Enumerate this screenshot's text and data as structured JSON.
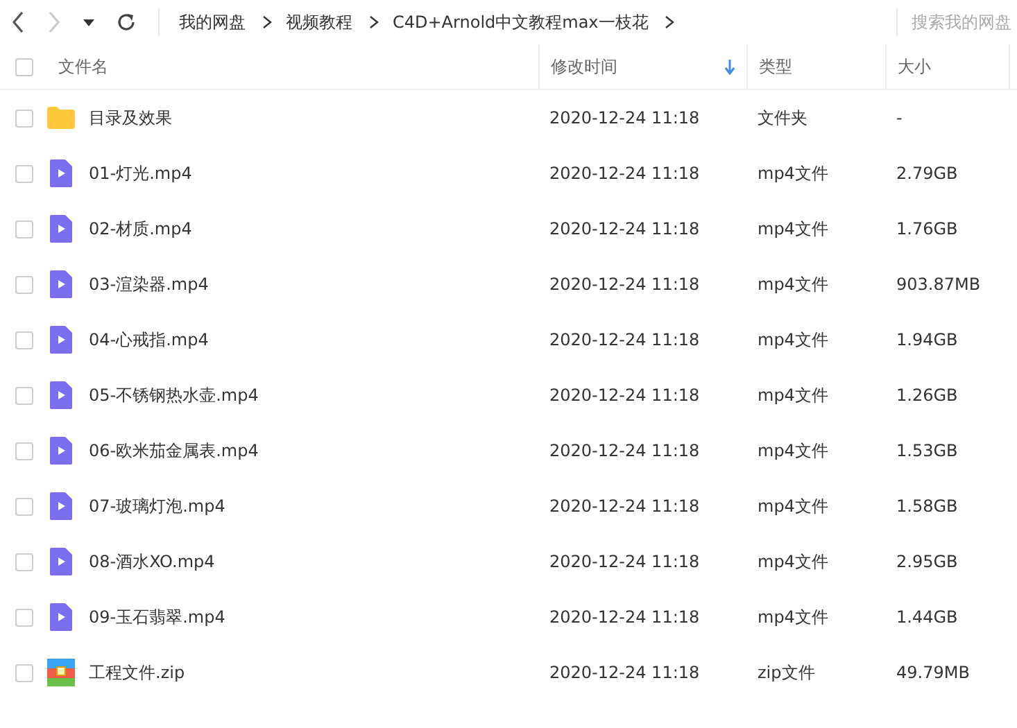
{
  "breadcrumbs": [
    "我的网盘",
    "视频教程",
    "C4D+Arnold中文教程max一枝花"
  ],
  "search": {
    "placeholder": "搜索我的网盘"
  },
  "select_all_checked": false,
  "columns": [
    {
      "label": "文件名",
      "sorted": false
    },
    {
      "label": "修改时间",
      "sorted": true
    },
    {
      "label": "类型",
      "sorted": false
    },
    {
      "label": "大小",
      "sorted": false
    }
  ],
  "rows": [
    {
      "kind": "folder",
      "name": "目录及效果",
      "modified": "2020-12-24 11:18",
      "type": "文件夹",
      "size": "-",
      "checked": false
    },
    {
      "kind": "video",
      "name": "01-灯光.mp4",
      "modified": "2020-12-24 11:18",
      "type": "mp4文件",
      "size": "2.79GB",
      "checked": false
    },
    {
      "kind": "video",
      "name": "02-材质.mp4",
      "modified": "2020-12-24 11:18",
      "type": "mp4文件",
      "size": "1.76GB",
      "checked": false
    },
    {
      "kind": "video",
      "name": "03-渲染器.mp4",
      "modified": "2020-12-24 11:18",
      "type": "mp4文件",
      "size": "903.87MB",
      "checked": false
    },
    {
      "kind": "video",
      "name": "04-心戒指.mp4",
      "modified": "2020-12-24 11:18",
      "type": "mp4文件",
      "size": "1.94GB",
      "checked": false
    },
    {
      "kind": "video",
      "name": "05-不锈钢热水壶.mp4",
      "modified": "2020-12-24 11:18",
      "type": "mp4文件",
      "size": "1.26GB",
      "checked": false
    },
    {
      "kind": "video",
      "name": "06-欧米茄金属表.mp4",
      "modified": "2020-12-24 11:18",
      "type": "mp4文件",
      "size": "1.53GB",
      "checked": false
    },
    {
      "kind": "video",
      "name": "07-玻璃灯泡.mp4",
      "modified": "2020-12-24 11:18",
      "type": "mp4文件",
      "size": "1.58GB",
      "checked": false
    },
    {
      "kind": "video",
      "name": "08-酒水XO.mp4",
      "modified": "2020-12-24 11:18",
      "type": "mp4文件",
      "size": "2.95GB",
      "checked": false
    },
    {
      "kind": "video",
      "name": "09-玉石翡翠.mp4",
      "modified": "2020-12-24 11:18",
      "type": "mp4文件",
      "size": "1.44GB",
      "checked": false
    },
    {
      "kind": "zip",
      "name": "工程文件.zip",
      "modified": "2020-12-24 11:18",
      "type": "zip文件",
      "size": "49.79MB",
      "checked": false
    }
  ]
}
